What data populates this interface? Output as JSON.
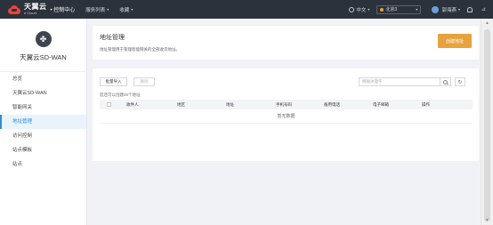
{
  "topbar": {
    "brand_cn": "天翼云",
    "brand_en": "e Cloud",
    "console": "• 控制中心",
    "nav": [
      {
        "label": "服务列表"
      },
      {
        "label": "收藏"
      }
    ],
    "language": "中文",
    "region": "北京3",
    "user": "郭海燕",
    "rss_icon": "rss-icon"
  },
  "sidebar": {
    "title": "天翼云SD-WAN",
    "items": [
      {
        "label": "总览"
      },
      {
        "label": "天翼云SD-WAN"
      },
      {
        "label": "智能网关"
      },
      {
        "label": "地址管理"
      },
      {
        "label": "访问控制"
      },
      {
        "label": "站点模板"
      },
      {
        "label": "站点"
      }
    ],
    "active_index": 3
  },
  "header": {
    "title": "地址管理",
    "description": "地址管理用于管理智能网关的全部收货地址。",
    "create_button": "创建地址"
  },
  "toolbar": {
    "import_label": "批量导入",
    "delete_label": "删除",
    "search_placeholder": "模糊关键字",
    "quota_text": "您还可以创建20个地址"
  },
  "table": {
    "columns": [
      "收件人",
      "地区",
      "地址",
      "手机号码",
      "备用电话",
      "电子邮箱",
      "操作"
    ],
    "empty_text": "暂无数据"
  },
  "colors": {
    "topbar_bg": "#2c323b",
    "accent": "#2b8fd6",
    "create_button": "#e6a23c"
  }
}
